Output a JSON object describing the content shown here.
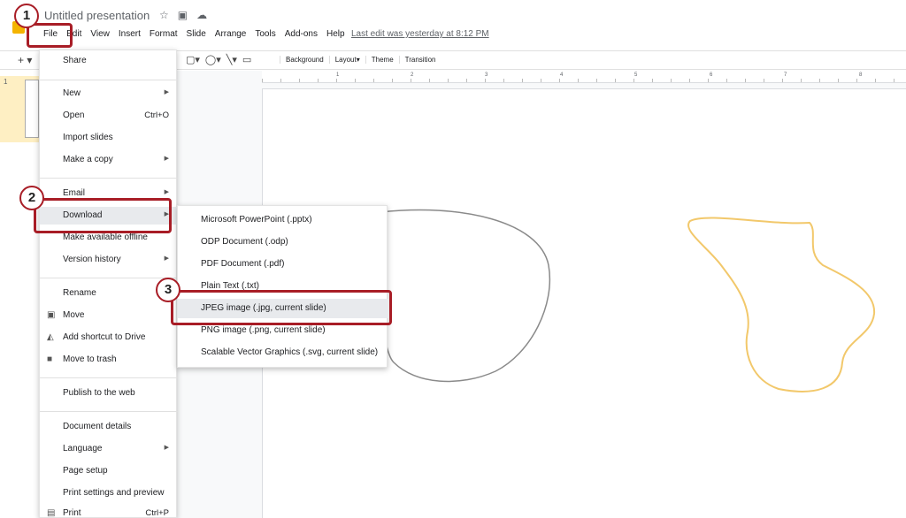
{
  "app": {
    "title": "Untitled presentation",
    "last_edit": "Last edit was yesterday at 8:12 PM"
  },
  "menubar": [
    "File",
    "Edit",
    "View",
    "Insert",
    "Format",
    "Slide",
    "Arrange",
    "Tools",
    "Add-ons",
    "Help"
  ],
  "toolbar": {
    "items": [
      "Background",
      "Layout▾",
      "Theme",
      "Transition"
    ]
  },
  "ruler": [
    "1",
    "2",
    "3",
    "4",
    "5",
    "6",
    "7",
    "8"
  ],
  "filmstrip": {
    "slide_number": "1"
  },
  "file_menu": {
    "share": "Share",
    "new": "New",
    "open": "Open",
    "open_shortcut": "Ctrl+O",
    "import_slides": "Import slides",
    "make_copy": "Make a copy",
    "email": "Email",
    "download": "Download",
    "make_offline": "Make available offline",
    "version_history": "Version history",
    "rename": "Rename",
    "move": "Move",
    "add_shortcut": "Add shortcut to Drive",
    "move_trash": "Move to trash",
    "publish": "Publish to the web",
    "doc_details": "Document details",
    "language": "Language",
    "page_setup": "Page setup",
    "print_settings": "Print settings and preview",
    "print": "Print",
    "print_shortcut": "Ctrl+P"
  },
  "download_menu": [
    "Microsoft PowerPoint (.pptx)",
    "ODP Document (.odp)",
    "PDF Document (.pdf)",
    "Plain Text (.txt)",
    "JPEG image (.jpg, current slide)",
    "PNG image (.png, current slide)",
    "Scalable Vector Graphics (.svg, current slide)"
  ],
  "steps": [
    "1",
    "2",
    "3"
  ],
  "colors": {
    "annotation": "#a81d26",
    "highlight": "#e8eaed",
    "orange_shape": "#f2c86b",
    "gray_shape": "#8a8a8a"
  }
}
